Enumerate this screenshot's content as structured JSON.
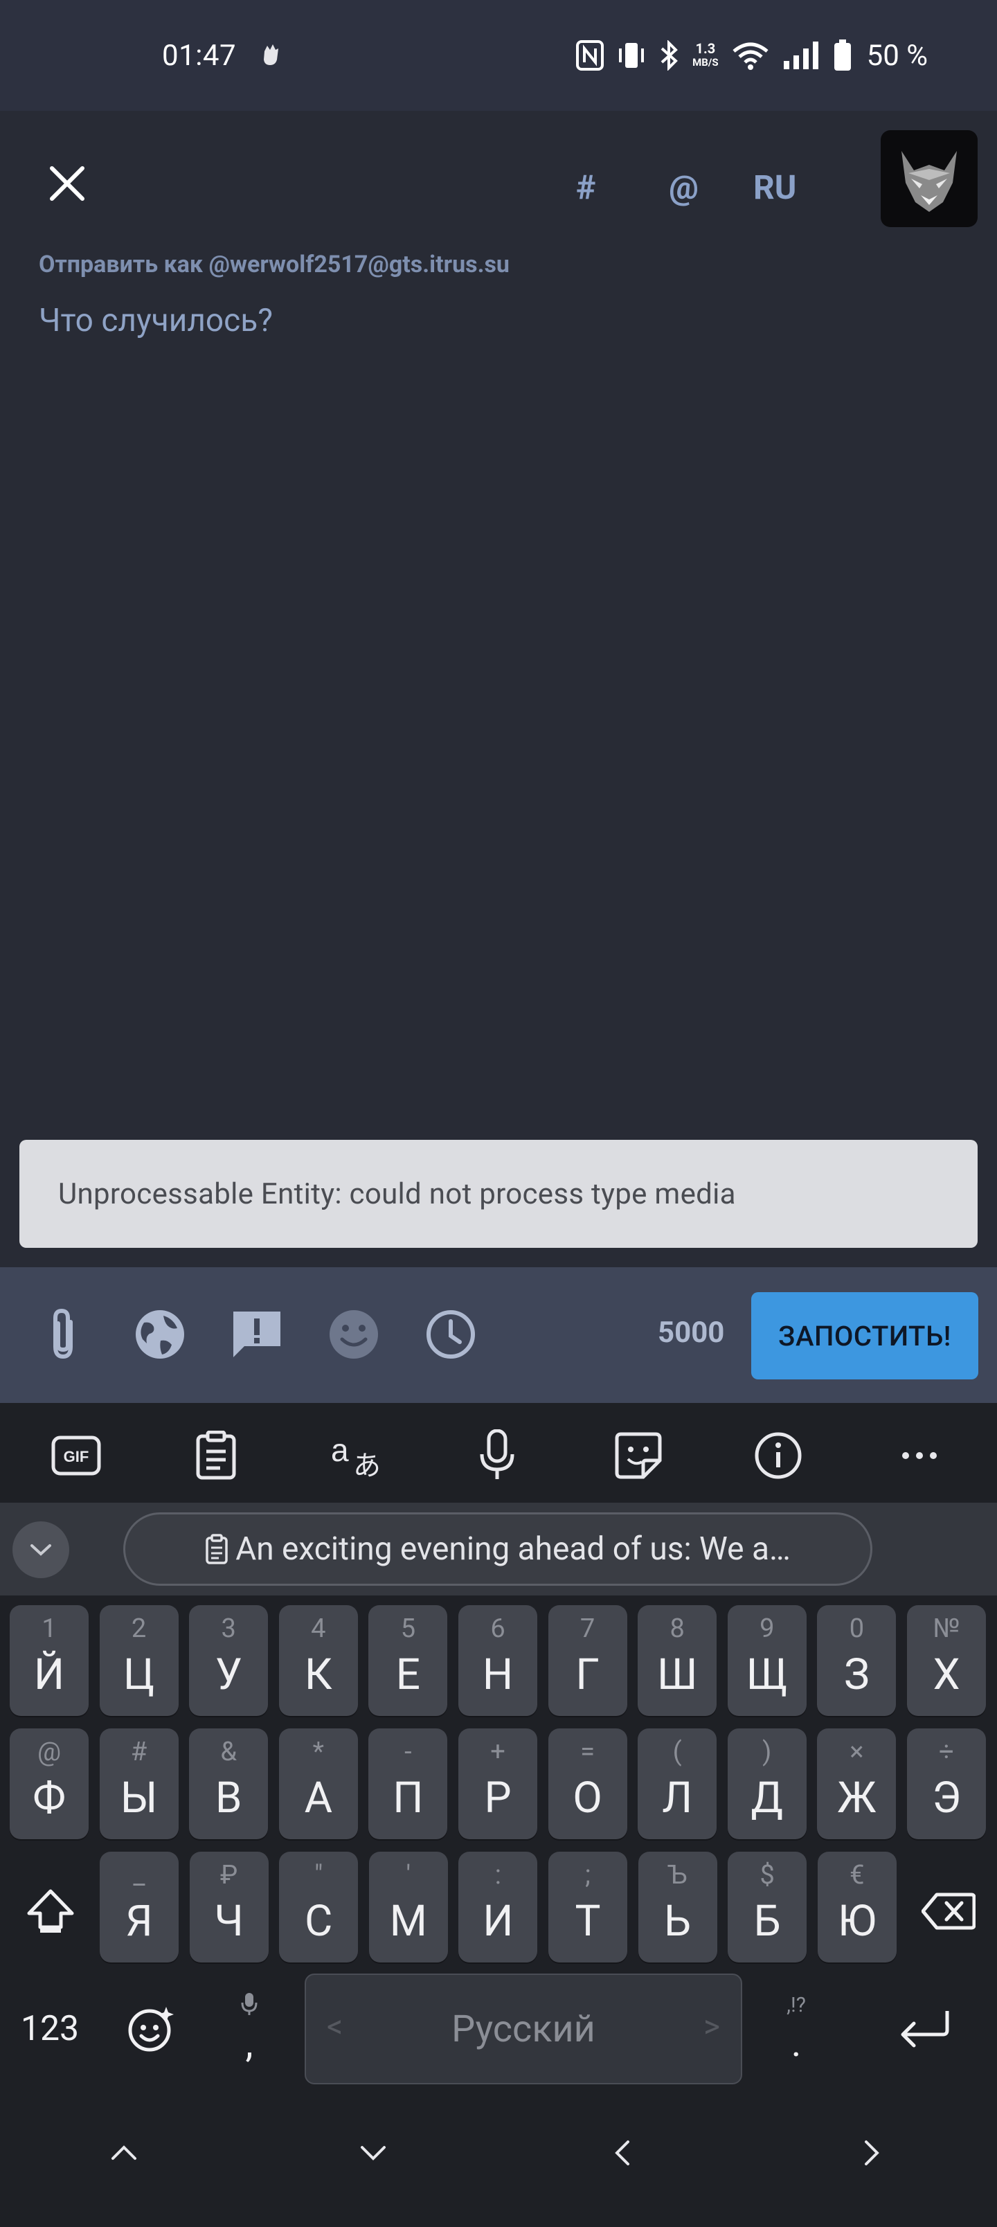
{
  "status_bar": {
    "time": "01:47",
    "net_speed": "1.3",
    "net_unit": "MB/S",
    "battery": "50 %"
  },
  "compose": {
    "hashtag_label": "#",
    "mention_label": "@",
    "language_label": "RU",
    "send_as": "Отправить как @werwolf2517@gts.itrus.su",
    "placeholder": "Что случилось?"
  },
  "error": {
    "message": "Unprocessable Entity: could not process  type media"
  },
  "bottom_bar": {
    "char_count": "5000",
    "post_label": "ЗАПОСТИТЬ!"
  },
  "keyboard": {
    "clipboard_suggestion": "An exciting evening ahead of us: We a…",
    "row1": [
      {
        "sec": "1",
        "pri": "Й"
      },
      {
        "sec": "2",
        "pri": "Ц"
      },
      {
        "sec": "3",
        "pri": "У"
      },
      {
        "sec": "4",
        "pri": "К"
      },
      {
        "sec": "5",
        "pri": "Е"
      },
      {
        "sec": "6",
        "pri": "Н"
      },
      {
        "sec": "7",
        "pri": "Г"
      },
      {
        "sec": "8",
        "pri": "Ш"
      },
      {
        "sec": "9",
        "pri": "Щ"
      },
      {
        "sec": "0",
        "pri": "З"
      },
      {
        "sec": "№",
        "pri": "Х"
      }
    ],
    "row2": [
      {
        "sec": "@",
        "pri": "Ф"
      },
      {
        "sec": "#",
        "pri": "Ы"
      },
      {
        "sec": "&",
        "pri": "В"
      },
      {
        "sec": "*",
        "pri": "А"
      },
      {
        "sec": "-",
        "pri": "П"
      },
      {
        "sec": "+",
        "pri": "Р"
      },
      {
        "sec": "=",
        "pri": "О"
      },
      {
        "sec": "(",
        "pri": "Л"
      },
      {
        "sec": ")",
        "pri": "Д"
      },
      {
        "sec": "×",
        "pri": "Ж"
      },
      {
        "sec": "÷",
        "pri": "Э"
      }
    ],
    "row3": [
      {
        "sec": "_",
        "pri": "Я"
      },
      {
        "sec": "₽",
        "pri": "Ч"
      },
      {
        "sec": "\"",
        "pri": "С"
      },
      {
        "sec": "'",
        "pri": "М"
      },
      {
        "sec": ":",
        "pri": "И"
      },
      {
        "sec": ";",
        "pri": "Т"
      },
      {
        "sec": "Ъ",
        "pri": "Ь"
      },
      {
        "sec": "$",
        "pri": "Б"
      },
      {
        "sec": "€",
        "pri": "Ю"
      }
    ],
    "numbers_label": "123",
    "comma_label": ",",
    "space_label": "Русский",
    "period_label": ".",
    "period_secondary": ",!?"
  }
}
